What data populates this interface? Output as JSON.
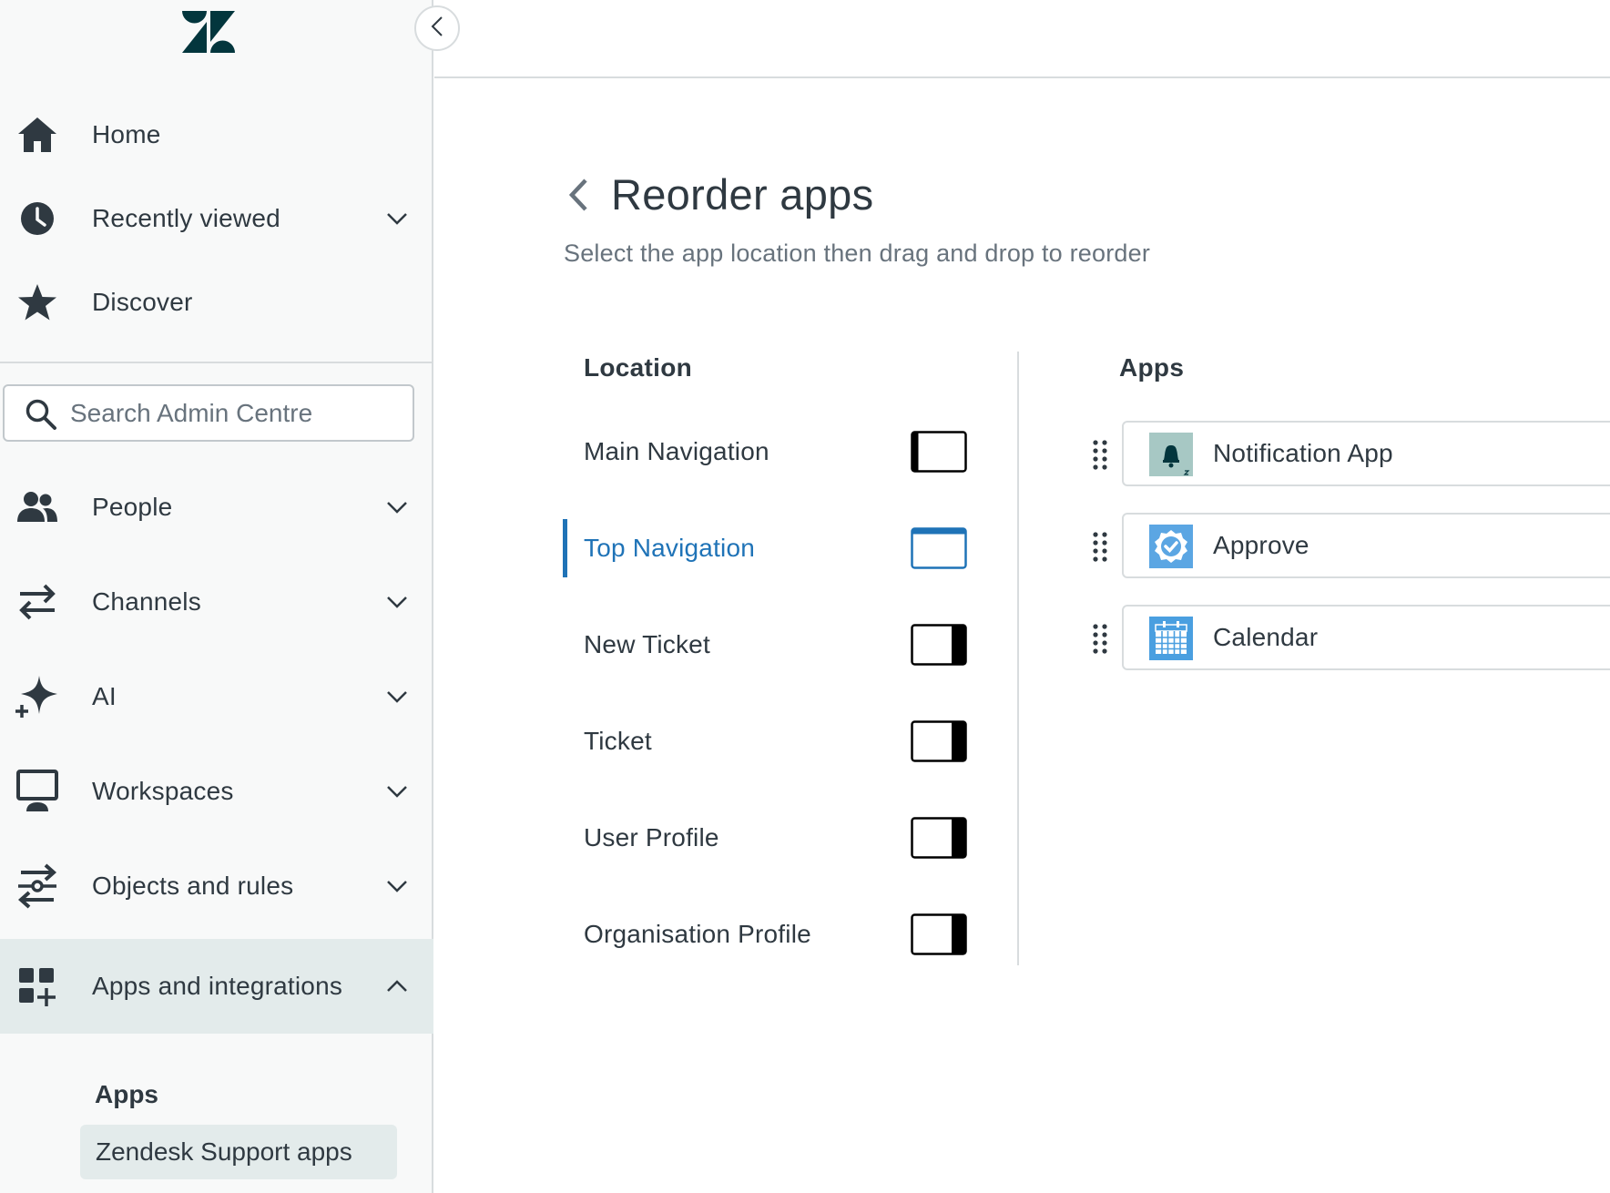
{
  "sidebar": {
    "logo_icon": "zendesk-logo",
    "collapse_icon": "chevron-left-icon",
    "top_items": [
      {
        "label": "Home",
        "icon": "home-icon"
      },
      {
        "label": "Recently viewed",
        "icon": "clock-icon",
        "expandable": true
      },
      {
        "label": "Discover",
        "icon": "star-icon"
      }
    ],
    "search": {
      "placeholder": "Search Admin Centre",
      "value": "",
      "icon": "search-icon"
    },
    "items": [
      {
        "label": "People",
        "icon": "people-icon",
        "expandable": true
      },
      {
        "label": "Channels",
        "icon": "channels-icon",
        "expandable": true
      },
      {
        "label": "AI",
        "icon": "sparkle-icon",
        "expandable": true
      },
      {
        "label": "Workspaces",
        "icon": "monitor-icon",
        "expandable": true
      },
      {
        "label": "Objects and rules",
        "icon": "objects-rules-icon",
        "expandable": true
      },
      {
        "label": "Apps and integrations",
        "icon": "apps-integrations-icon",
        "expanded": true,
        "active": true
      }
    ],
    "submenu": {
      "heading": "Apps",
      "items": [
        {
          "label": "Zendesk Support apps",
          "selected": true
        }
      ]
    }
  },
  "page": {
    "title": "Reorder apps",
    "subtitle": "Select the app location then drag and drop to reorder",
    "back_icon": "chevron-left-icon"
  },
  "locations": {
    "heading": "Location",
    "items": [
      {
        "label": "Main Navigation",
        "icon": "main-navigation-layout-icon"
      },
      {
        "label": "Top Navigation",
        "icon": "top-navigation-layout-icon",
        "selected": true
      },
      {
        "label": "New Ticket",
        "icon": "new-ticket-layout-icon"
      },
      {
        "label": "Ticket",
        "icon": "ticket-layout-icon"
      },
      {
        "label": "User Profile",
        "icon": "user-profile-layout-icon"
      },
      {
        "label": "Organisation Profile",
        "icon": "organisation-profile-layout-icon"
      }
    ]
  },
  "apps": {
    "heading": "Apps",
    "items": [
      {
        "label": "Notification App",
        "icon": "bell-app-icon"
      },
      {
        "label": "Approve",
        "icon": "approve-badge-app-icon"
      },
      {
        "label": "Calendar",
        "icon": "calendar-app-icon"
      }
    ]
  },
  "colors": {
    "accent": "#1f73b7",
    "sidebar_bg": "#f8f9f9",
    "active_bg": "#e3ebeb",
    "text": "#2f3941",
    "muted": "#68737d",
    "border": "#d8dcde"
  }
}
